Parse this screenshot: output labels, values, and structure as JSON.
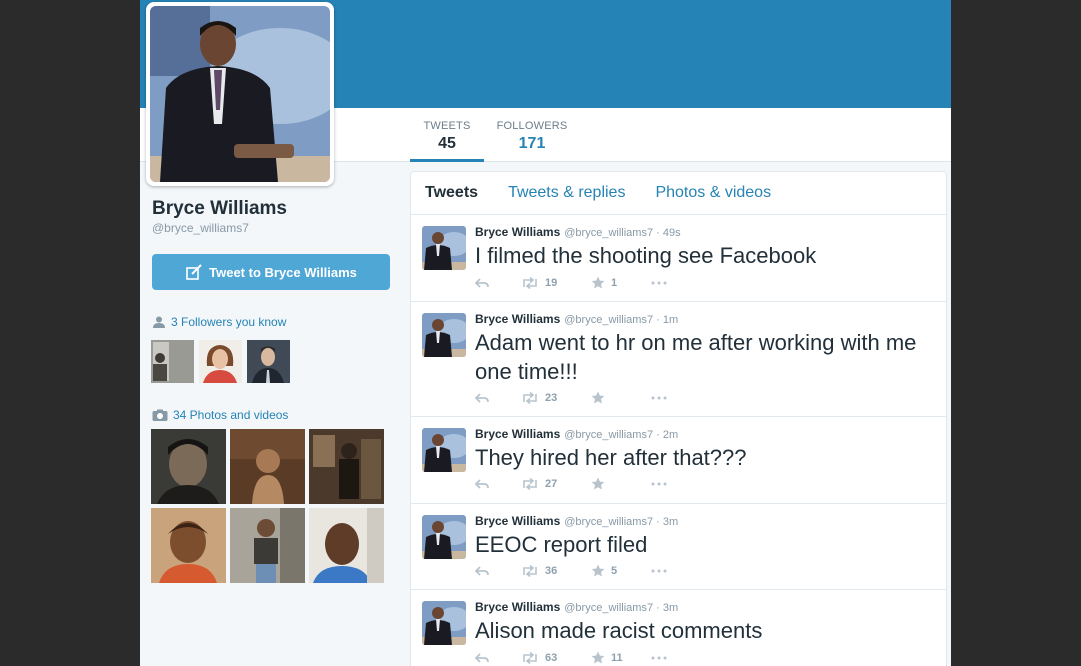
{
  "profile": {
    "name": "Bryce Williams",
    "handle": "@bryce_williams7",
    "tweet_to_label": "Tweet to Bryce Williams"
  },
  "stats": {
    "tweets_label": "TWEETS",
    "tweets_value": "45",
    "followers_label": "FOLLOWERS",
    "followers_value": "171"
  },
  "sidebar": {
    "followers_you_know": "3 Followers you know",
    "photos_videos": "34 Photos and videos"
  },
  "tabs": [
    {
      "label": "Tweets"
    },
    {
      "label": "Tweets & replies"
    },
    {
      "label": "Photos & videos"
    }
  ],
  "tweets": [
    {
      "name": "Bryce Williams",
      "meta": "@bryce_williams7 · 49s",
      "text": "I filmed the shooting see Facebook",
      "retweets": "19",
      "favorites": "1"
    },
    {
      "name": "Bryce Williams",
      "meta": "@bryce_williams7 · 1m",
      "text": "Adam went to hr on me after working with me one time!!!",
      "retweets": "23",
      "favorites": ""
    },
    {
      "name": "Bryce Williams",
      "meta": "@bryce_williams7 · 2m",
      "text": "They hired her after that???",
      "retweets": "27",
      "favorites": ""
    },
    {
      "name": "Bryce Williams",
      "meta": "@bryce_williams7 · 3m",
      "text": "EEOC report filed",
      "retweets": "36",
      "favorites": "5"
    },
    {
      "name": "Bryce Williams",
      "meta": "@bryce_williams7 · 3m",
      "text": "Alison made racist comments",
      "retweets": "63",
      "favorites": "11"
    }
  ],
  "icons": {
    "reply": "reply-icon",
    "retweet": "retweet-icon",
    "favorite": "star-icon",
    "more": "more-icon",
    "follower": "person-icon",
    "camera": "camera-icon",
    "compose": "compose-icon"
  },
  "colors": {
    "brand": "#2583b5",
    "button": "#4fa7d6",
    "text": "#22303a",
    "muted": "#8899a6"
  }
}
